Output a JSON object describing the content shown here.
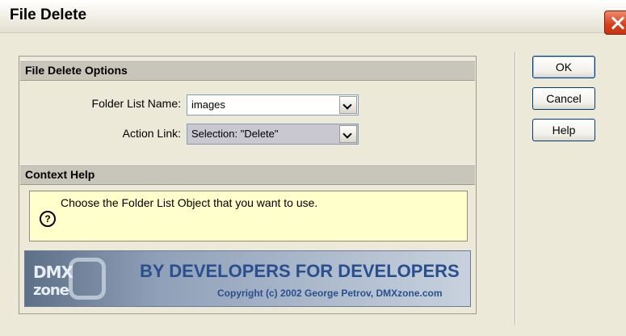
{
  "window": {
    "title": "File Delete"
  },
  "options_section": {
    "heading": "File Delete Options",
    "folder_list_label": "Folder List Name:",
    "folder_list_value": "images",
    "action_link_label": "Action Link:",
    "action_link_value": "Selection: \"Delete\""
  },
  "context_help": {
    "heading": "Context Help",
    "icon": "?",
    "text": "Choose the Folder List Object that you want to use."
  },
  "banner": {
    "logo_top": "DMX",
    "logo_bottom": "zone",
    "slogan": "BY DEVELOPERS FOR DEVELOPERS",
    "copyright": "Copyright (c) 2002 George Petrov, DMXzone.com"
  },
  "buttons": {
    "ok": "OK",
    "cancel": "Cancel",
    "help": "Help"
  }
}
